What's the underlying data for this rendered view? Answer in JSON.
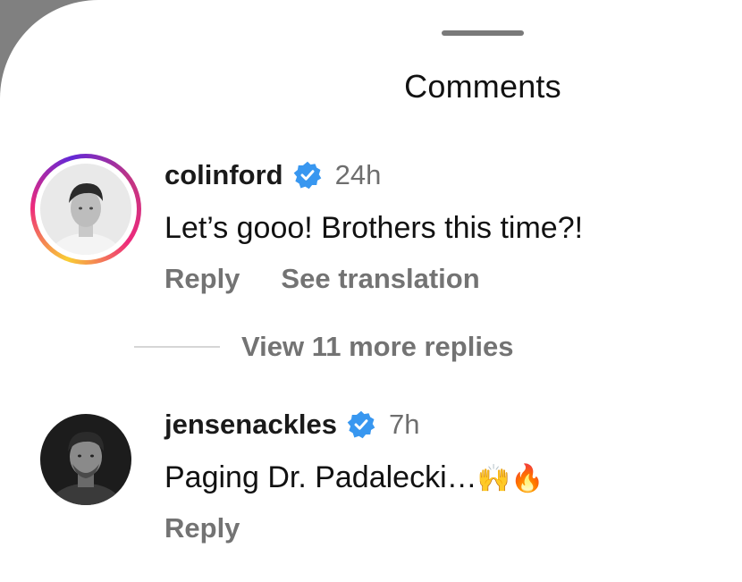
{
  "sheet": {
    "title": "Comments"
  },
  "comments": [
    {
      "username": "colinford",
      "verified": true,
      "time": "24h",
      "text": "Let’s gooo! Brothers this time?!",
      "emojis": "",
      "has_story_ring": true,
      "actions": [
        "Reply",
        "See translation"
      ]
    },
    {
      "username": "jensenackles",
      "verified": true,
      "time": "7h",
      "text": "Paging Dr. Padalecki…",
      "emojis": "🙌🔥",
      "has_story_ring": false,
      "actions": [
        "Reply"
      ]
    }
  ],
  "replies": {
    "view_more_label": "View 11 more replies"
  },
  "colors": {
    "verified_badge": "#3897f0",
    "secondary_text": "#737373"
  },
  "icons": {
    "verified": "verified-badge-icon"
  }
}
